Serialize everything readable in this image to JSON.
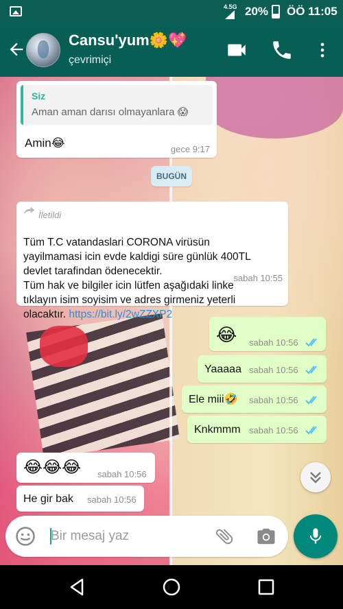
{
  "status_bar": {
    "network": "4.5G",
    "battery": "20%",
    "time": "ÖÖ 11:05"
  },
  "header": {
    "contact_name": "Cansu'yum🌼💖",
    "contact_status": "çevrimiçi",
    "icons": [
      "back-arrow-icon",
      "video-call-icon",
      "phone-icon",
      "more-vert-icon"
    ]
  },
  "messages": {
    "m1": {
      "direction": "incoming",
      "reply_to_author": "Siz",
      "reply_to_text": "Aman aman darısı olmayanlara 😱",
      "text": "Amin😂",
      "time": "gece 9:17"
    },
    "date_separator": "BUGÜN",
    "m2": {
      "direction": "incoming",
      "forwarded_label": "İletildi",
      "text": "Tüm T.C vatandaslari  CORONA virüsün\nyayilmamasi icin evde kaldigi süre günlük 400TL\ndevlet tarafindan ödenecektir.\nTüm hak ve bilgiler icin lütfen aşağıdaki linke\ntıklayın isim soyisim ve adres girmeniz yeterli\nolacaktır. ",
      "link": "https://bit.ly/2wZZXP2",
      "time": "sabah 10:55"
    },
    "m3": {
      "direction": "outgoing",
      "text": "😂",
      "time": "sabah 10:56"
    },
    "m4": {
      "direction": "outgoing",
      "text": "Yaaaaa",
      "time": "sabah 10:56"
    },
    "m5": {
      "direction": "outgoing",
      "text": "Ele miii🤣",
      "time": "sabah 10:56"
    },
    "m6": {
      "direction": "outgoing",
      "text": "Knkmmm",
      "time": "sabah 10:56"
    },
    "m7": {
      "direction": "incoming",
      "text": "😂😂😂",
      "time": "sabah 10:56"
    },
    "m8": {
      "direction": "incoming",
      "text": "He gir bak",
      "time": "sabah 10:56"
    }
  },
  "composer": {
    "placeholder": "Bir mesaj yaz",
    "icons": [
      "emoji-icon",
      "attach-icon",
      "camera-icon",
      "mic-icon"
    ]
  },
  "colors": {
    "header": "#075e54",
    "outgoing_bubble": "#e1fec6",
    "incoming_bubble": "#ffffff",
    "read_ticks": "#4fc3f7",
    "mic_button": "#00897b",
    "link": "#2a8fd6"
  }
}
